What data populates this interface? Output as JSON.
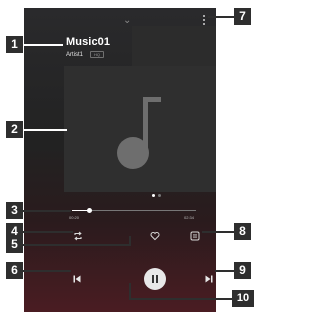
{
  "player": {
    "title": "Music01",
    "artist": "Artist1",
    "badge": "HQ",
    "time_elapsed": "00:20",
    "time_total": "02:34",
    "progress": 0.14,
    "pager": {
      "count": 2,
      "active": 1
    },
    "state": "playing"
  },
  "icons": {
    "collapse": "chevron-down-icon",
    "menu": "more-vert-icon",
    "repeat": "repeat-icon",
    "favorite": "heart-outline-icon",
    "queue": "playlist-icon",
    "previous": "skip-previous-icon",
    "play_pause": "pause-icon",
    "next": "skip-next-icon"
  },
  "callouts": [
    "1",
    "2",
    "3",
    "4",
    "5",
    "6",
    "7",
    "8",
    "9",
    "10"
  ],
  "colors": {
    "callout_bg": "#2e2e2e",
    "accent_gradient_bottom": "#4a1c22",
    "control_fill": "#e8e8e8"
  }
}
